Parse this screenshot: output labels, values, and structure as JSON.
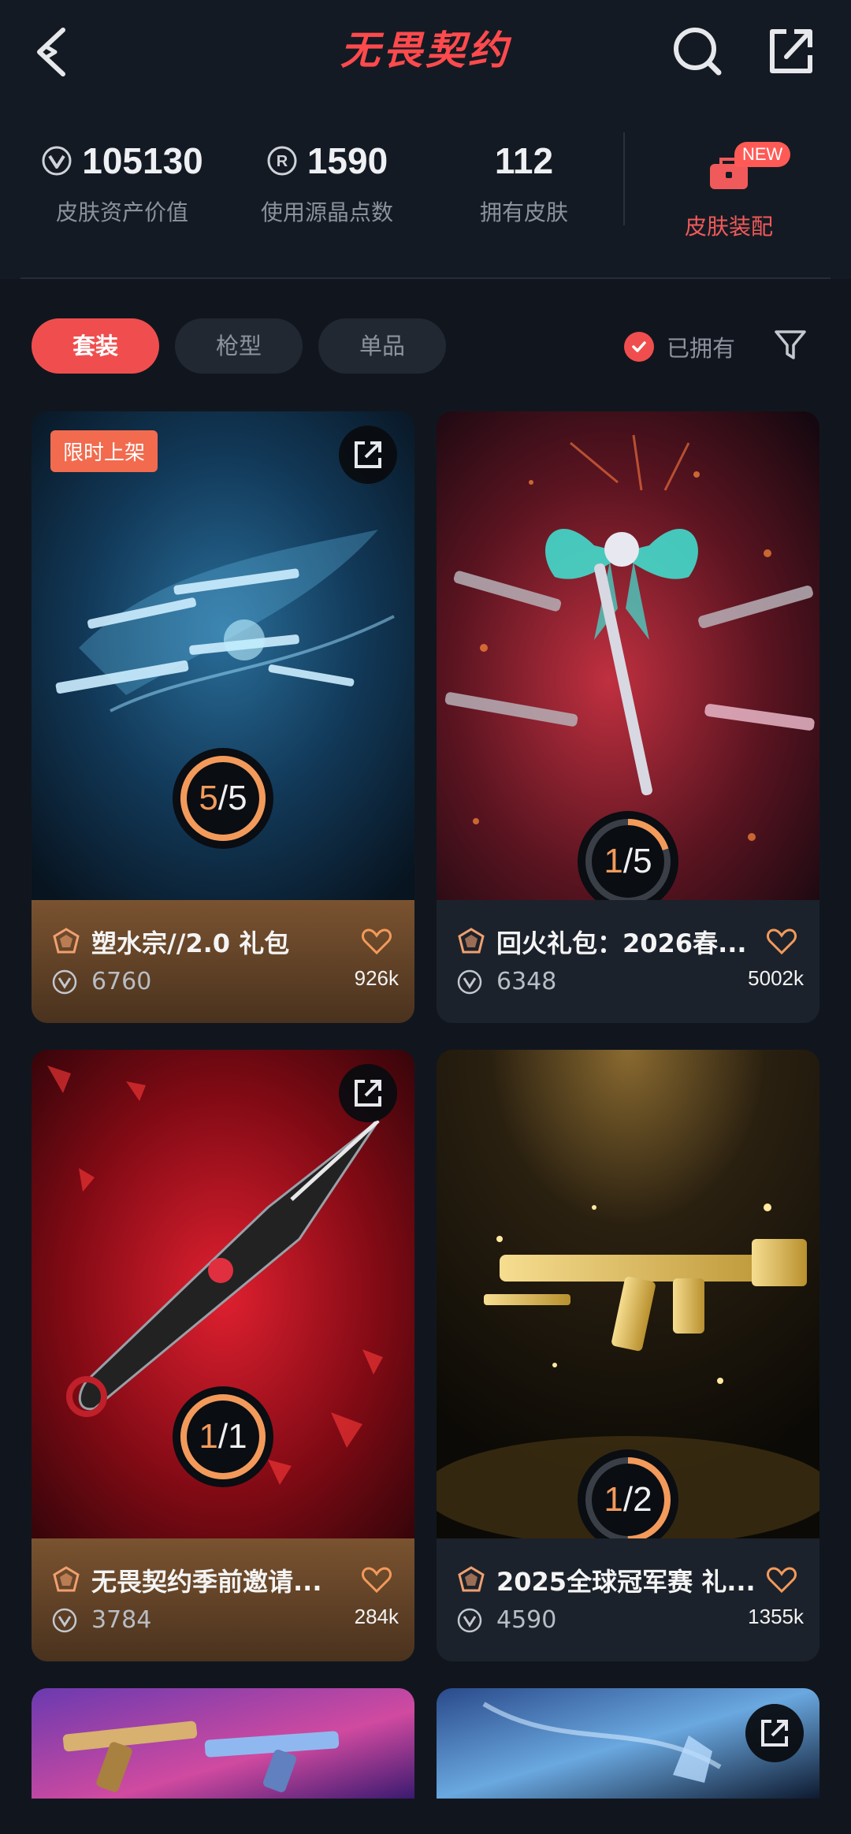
{
  "header": {
    "title": "无畏契约"
  },
  "stats": {
    "asset_value": "105130",
    "asset_label": "皮肤资产价值",
    "radianite": "1590",
    "radianite_label": "使用源晶点数",
    "owned_skins": "112",
    "owned_label": "拥有皮肤",
    "equip_label": "皮肤装配",
    "new_badge": "NEW"
  },
  "filters": {
    "tabs": [
      "套装",
      "枪型",
      "单品"
    ],
    "owned_label": "已拥有"
  },
  "cards": [
    {
      "name": "塑水宗//2.0 礼包",
      "price": "6760",
      "likes": "926k",
      "owned": "5",
      "total": "5",
      "progress": 1.0,
      "tag": "限时上架"
    },
    {
      "name": "回火礼包：2026春...",
      "price": "6348",
      "likes": "5002k",
      "owned": "1",
      "total": "5",
      "progress": 0.2
    },
    {
      "name": "无畏契约季前邀请...",
      "price": "3784",
      "likes": "284k",
      "owned": "1",
      "total": "1",
      "progress": 1.0
    },
    {
      "name": "2025全球冠军赛 礼...",
      "price": "4590",
      "likes": "1355k",
      "owned": "1",
      "total": "2",
      "progress": 0.5
    }
  ],
  "colors": {
    "accent": "#f04e4e",
    "ring": "#f39a5a",
    "brand": "#ff4a4d"
  }
}
